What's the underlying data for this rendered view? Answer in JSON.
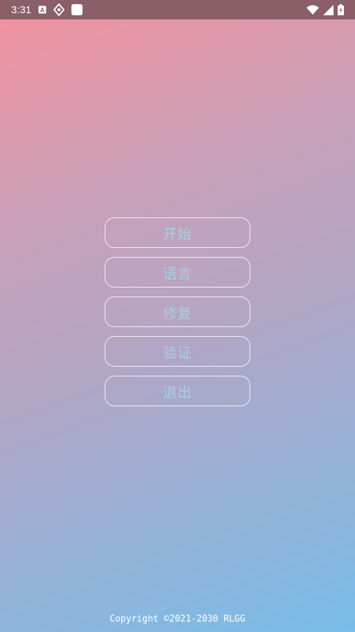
{
  "status_bar": {
    "time": "3:31",
    "icons_left": [
      "text-a-icon",
      "android-debug-icon",
      "square-app-icon"
    ],
    "icons_right": [
      "wifi-icon",
      "cellular-signal-icon",
      "battery-charging-icon"
    ]
  },
  "menu": {
    "start_label": "开始",
    "language_label": "语言",
    "repair_label": "修复",
    "verify_label": "验证",
    "exit_label": "退出"
  },
  "footer": {
    "copyright": "Copyright ©2021-2030 RLGG"
  },
  "colors": {
    "gradient_top_left": "#f3919c",
    "gradient_bottom_right": "#79bde9",
    "button_text": "#a9cfe2",
    "button_border": "#ffffff",
    "status_bar_bg": "#8a5f67"
  }
}
